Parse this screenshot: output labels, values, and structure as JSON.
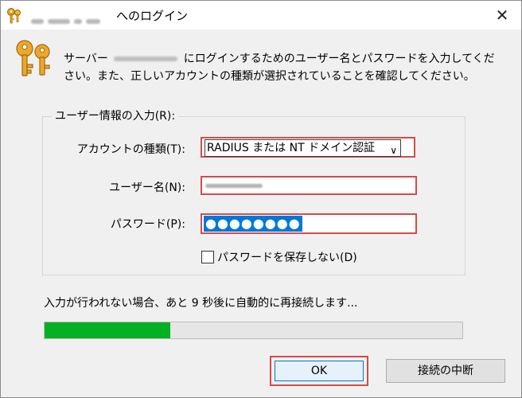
{
  "window": {
    "title_suffix": "へのログイン",
    "close_glyph": "✕"
  },
  "intro": {
    "line_part1": "サーバー",
    "line_part2": "にログインするためのユーザー名とパスワードを入力してくだ",
    "line_part3": "さい。また、正しいアカウントの種類が選択されていることを確認してください。"
  },
  "group": {
    "title": "ユーザー情報の入力(R):"
  },
  "account_type": {
    "label": "アカウントの種類(T):",
    "value": "RADIUS または NT ドメイン認証",
    "arrow": "∨"
  },
  "username": {
    "label": "ユーザー名(N):"
  },
  "password": {
    "label": "パスワード(P):",
    "masked": "●●●●●●●●"
  },
  "save_password": {
    "label": "パスワードを保存しない(D)",
    "checked": false
  },
  "countdown": {
    "text": "入力が行われない場合、あと 9 秒後に自動的に再接続します..."
  },
  "progress": {
    "fraction": 0.3
  },
  "buttons": {
    "ok": "OK",
    "cancel": "接続の中断"
  },
  "colors": {
    "progress_green": "#06b025",
    "highlight_red": "#d54b4b",
    "selection_blue": "#0078d7"
  },
  "icons": {
    "title": "keys-icon",
    "dialog": "keys-icon"
  }
}
